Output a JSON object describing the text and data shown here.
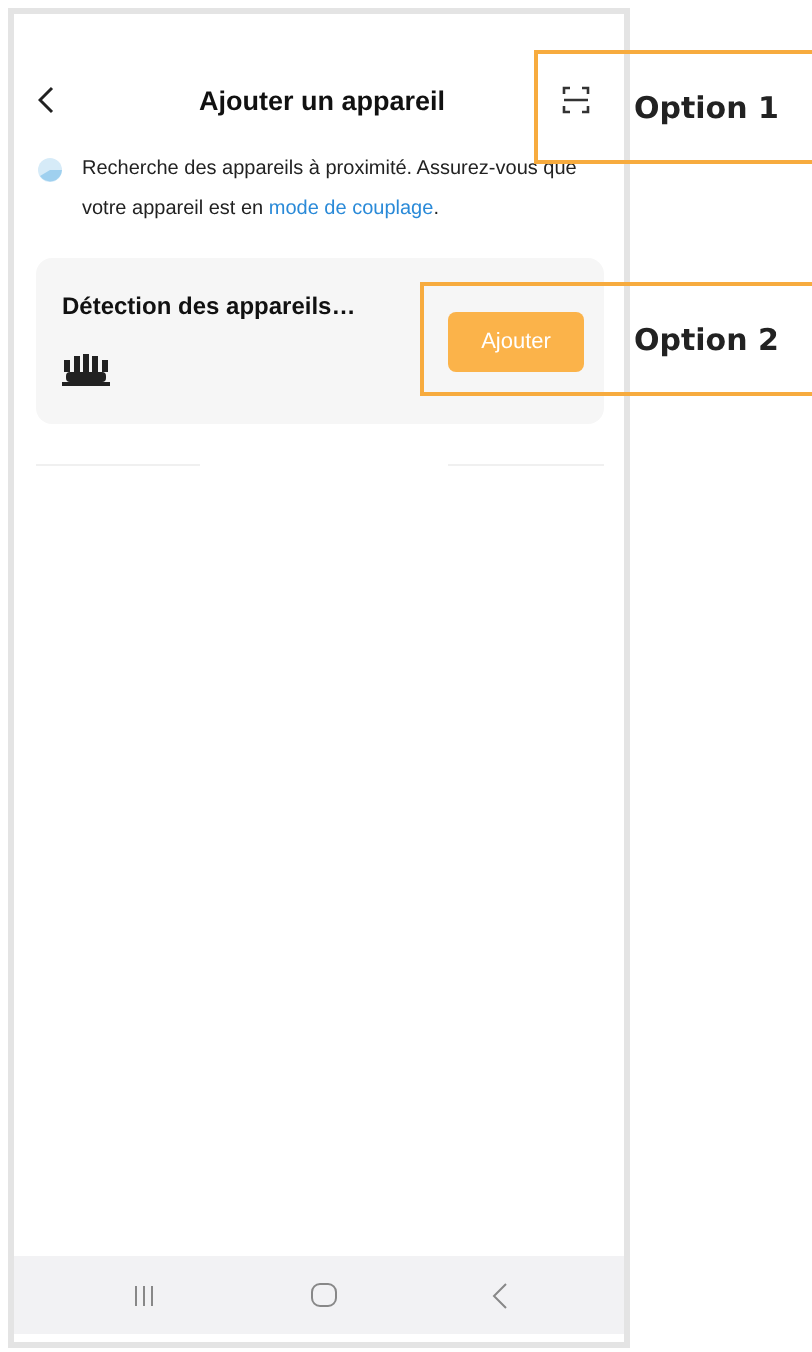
{
  "header": {
    "title": "Ajouter un appareil"
  },
  "search": {
    "text": "Recherche des appareils à proximité. Assurez-vous que votre appareil est en ",
    "link": "mode de couplage",
    "after": "."
  },
  "card": {
    "title": "Détection des appareils…",
    "button": "Ajouter"
  },
  "callouts": [
    {
      "label": "Option 1"
    },
    {
      "label": "Option 2"
    }
  ]
}
